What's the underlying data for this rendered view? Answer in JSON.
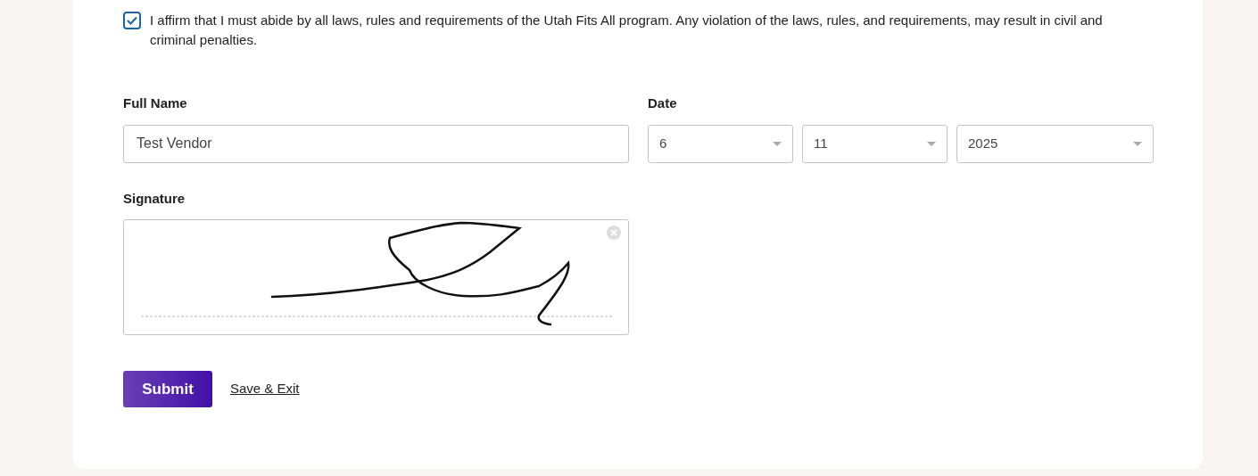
{
  "affirmation": {
    "checked": true,
    "text": "I affirm that I must abide by all laws, rules and requirements of the Utah Fits All program. Any violation of the laws, rules, and requirements, may result in civil and criminal penalties."
  },
  "full_name": {
    "label": "Full Name",
    "value": "Test Vendor"
  },
  "date": {
    "label": "Date",
    "parts": [
      {
        "value": "6"
      },
      {
        "value": "11"
      },
      {
        "value": "2025"
      }
    ]
  },
  "signature": {
    "label": "Signature",
    "signed": true
  },
  "buttons": [
    {
      "label": "Submit",
      "kind": "primary"
    },
    {
      "label": "Save & Exit",
      "kind": "link"
    }
  ]
}
